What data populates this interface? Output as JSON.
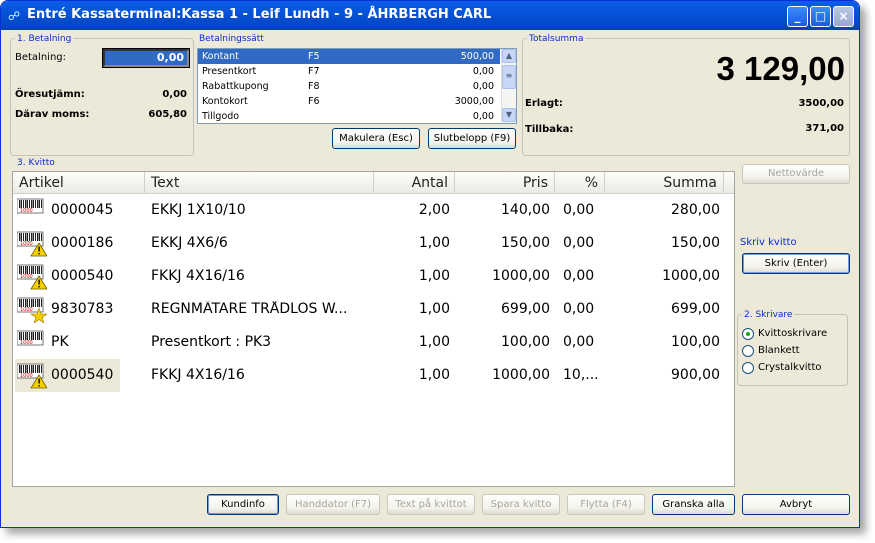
{
  "window": {
    "title": "Entré Kassaterminal:Kassa 1 - Leif Lundh - 9 - ÅHRBERGH CARL",
    "minimize": "_",
    "maximize": "□",
    "close": "×"
  },
  "betalning": {
    "group_label": "1. Betalning",
    "field_label": "Betalning:",
    "field_value": "0,00",
    "oresutjamn_label": "Öresutjämn:",
    "oresutjamn_value": "0,00",
    "moms_label": "Därav moms:",
    "moms_value": "605,80"
  },
  "betalningssatt": {
    "group_label": "Betalningssätt",
    "items": [
      {
        "name": "Kontant",
        "key": "F5",
        "amount": "500,00",
        "selected": true
      },
      {
        "name": "Presentkort",
        "key": "F7",
        "amount": "0,00"
      },
      {
        "name": "Rabattkupong",
        "key": "F8",
        "amount": "0,00"
      },
      {
        "name": "Kontokort",
        "key": "F6",
        "amount": "3000,00"
      },
      {
        "name": "Tillgodo",
        "key": "",
        "amount": "0,00"
      }
    ],
    "makulera_button": "Makulera (Esc)",
    "slutbelopp_button": "Slutbelopp (F9)"
  },
  "totalsumma": {
    "group_label": "Totalsumma",
    "total": "3 129,00",
    "erlagt_label": "Erlagt:",
    "erlagt_value": "3500,00",
    "tillbaka_label": "Tillbaka:",
    "tillbaka_value": "371,00"
  },
  "kvitto": {
    "group_label": "3. Kvitto",
    "columns": [
      "Artikel",
      "Text",
      "Antal",
      "Pris",
      "%",
      "Summa"
    ],
    "rows": [
      {
        "artikel": "0000045",
        "text": "EKKJ 1X10/10",
        "antal": "2,00",
        "pris": "140,00",
        "pct": "0,00",
        "summa": "280,00",
        "icon": "barcode-icon"
      },
      {
        "artikel": "0000186",
        "text": "EKKJ 4X6/6",
        "antal": "1,00",
        "pris": "150,00",
        "pct": "0,00",
        "summa": "150,00",
        "icon": "barcode-warning-icon"
      },
      {
        "artikel": "0000540",
        "text": "FKKJ 4X16/16",
        "antal": "1,00",
        "pris": "1000,00",
        "pct": "0,00",
        "summa": "1000,00",
        "icon": "barcode-warning-icon"
      },
      {
        "artikel": "9830783",
        "text": "REGNMÄTARE TRÅDLÖS W...",
        "antal": "1,00",
        "pris": "699,00",
        "pct": "0,00",
        "summa": "699,00",
        "icon": "barcode-star-icon"
      },
      {
        "artikel": "PK",
        "text": "Presentkort : PK3",
        "antal": "1,00",
        "pris": "100,00",
        "pct": "0,00",
        "summa": "100,00",
        "icon": "barcode-icon"
      },
      {
        "artikel": "0000540",
        "text": "FKKJ 4X16/16",
        "antal": "1,00",
        "pris": "1000,00",
        "pct": "10,...",
        "summa": "900,00",
        "icon": "barcode-warning-icon"
      }
    ]
  },
  "side": {
    "nettovarde_button": "Nettovärde",
    "skriv_kvitto_label": "Skriv kvitto",
    "skriv_button": "Skriv (Enter)",
    "skrivare_label": "2. Skrivare",
    "printers": [
      {
        "label": "Kvittoskrivare",
        "selected": true
      },
      {
        "label": "Blankett",
        "selected": false
      },
      {
        "label": "Crystalkvitto",
        "selected": false
      }
    ]
  },
  "bottom_buttons": {
    "kundinfo": "Kundinfo",
    "handdator": "Handdator (F7)",
    "text_pa_kvittot": "Text på kvittot",
    "spara_kvitto": "Spara kvitto",
    "flytta": "Flytta (F4)",
    "granska_alla": "Granska alla",
    "avbryt": "Avbryt"
  },
  "colors": {
    "title_blue": "#0553d8",
    "selection": "#316ac5",
    "group_label": "#0a2bd0",
    "window_bg": "#ece9d8"
  }
}
